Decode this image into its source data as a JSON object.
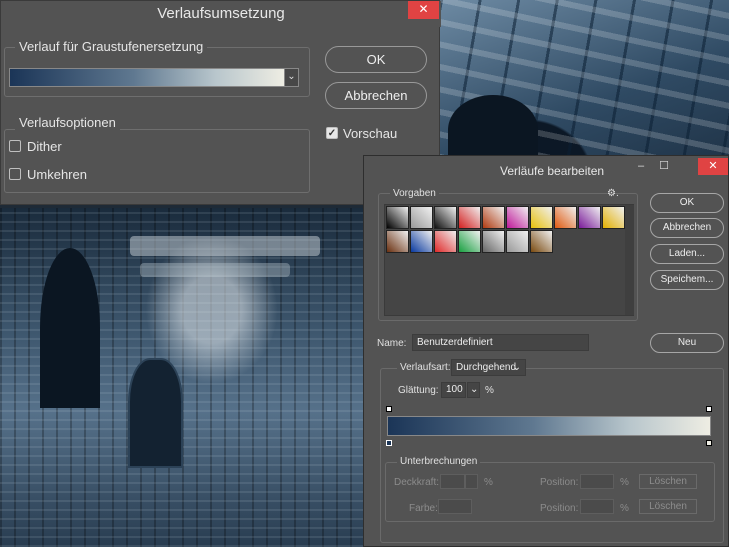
{
  "map_dialog": {
    "title": "Verlaufsumsetzung",
    "close_glyph": "✕",
    "gradient_group_label": "Verlauf für Graustufenersetzung",
    "options_group_label": "Verlaufsoptionen",
    "dither_label": "Dither",
    "dither_checked": false,
    "reverse_label": "Umkehren",
    "reverse_checked": false,
    "ok_label": "OK",
    "cancel_label": "Abbrechen",
    "preview_label": "Vorschau",
    "preview_checked": true,
    "dropdown_glyph": "⌄"
  },
  "editor_dialog": {
    "title": "Verläufe bearbeiten",
    "minimize_glyph": "–",
    "maximize_glyph": "☐",
    "close_glyph": "✕",
    "presets_label": "Vorgaben",
    "gear_glyph": "⚙.",
    "buttons": {
      "ok": "OK",
      "cancel": "Abbrechen",
      "load": "Laden...",
      "save": "Speichem...",
      "new": "Neu"
    },
    "name_label": "Name:",
    "name_value": "Benutzerdefiniert",
    "type_label": "Verlaufsart:",
    "type_value": "Durchgehend",
    "smoothness_label": "Glättung:",
    "smoothness_value": "100",
    "percent": "%",
    "stops_group_label": "Unterbrechungen",
    "opacity_label": "Deckkraft:",
    "color_label": "Farbe:",
    "position_label": "Position:",
    "delete_label": "Löschen",
    "swatch_colors_row1": [
      "#000000",
      "#9a9a9a",
      "#111111",
      "#d42020",
      "#b03a10",
      "#c0189a",
      "#e8c00a",
      "#e05a10",
      "#7a1a9a",
      "#e3b000"
    ],
    "swatch_colors_row2": [
      "#6a3010",
      "#0a3aa0",
      "#e02a2a",
      "#18a040",
      "#666666",
      "#9a9a9a",
      "#7a4a10"
    ]
  }
}
